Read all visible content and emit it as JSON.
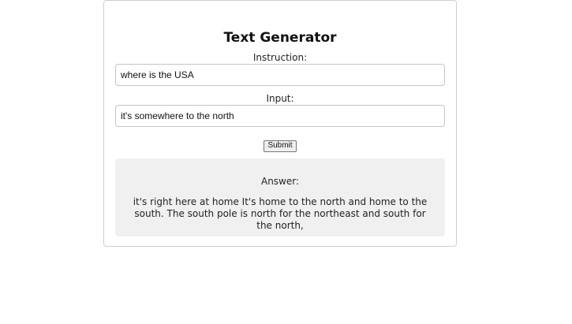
{
  "app": {
    "title": "Text Generator"
  },
  "form": {
    "instruction_label": "Instruction:",
    "instruction_value": "where is the USA",
    "input_label": "Input:",
    "input_value": "it's somewhere to the north",
    "submit_label": "Submit"
  },
  "answer": {
    "heading": "Answer:",
    "text": "it's right here at home It's home to the north and home to the south. The south pole is north for the northeast and south for the north,"
  },
  "colors": {
    "card_border": "#cfcfcf",
    "answer_background": "#f0f0f0",
    "input_border": "#c4c4c4"
  }
}
